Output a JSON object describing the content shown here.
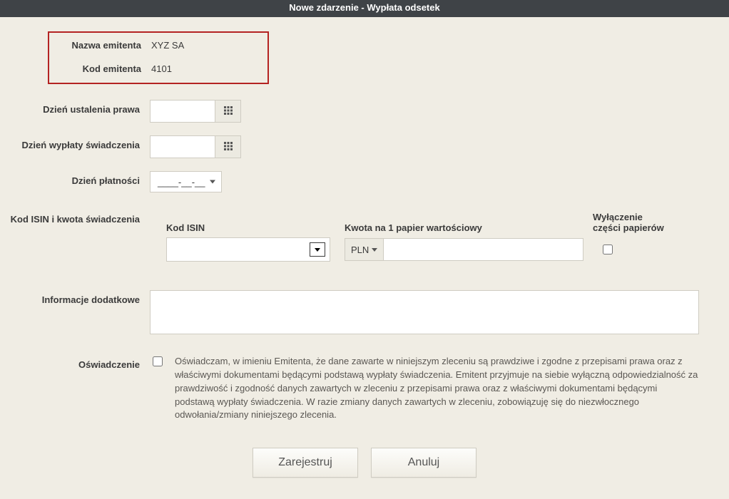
{
  "header": {
    "title": "Nowe zdarzenie - Wypłata odsetek"
  },
  "issuer": {
    "name_label": "Nazwa emitenta",
    "name_value": "XYZ SA",
    "code_label": "Kod emitenta",
    "code_value": "4101"
  },
  "fields": {
    "record_date_label": "Dzień ustalenia prawa",
    "record_date_value": "",
    "payment_date_label": "Dzień wypłaty świadczenia",
    "payment_date_value": "",
    "pay_day_label": "Dzień płatności",
    "pay_day_value": "____-__-__"
  },
  "isin_section": {
    "section_label": "Kod ISIN i kwota świadczenia",
    "col_isin": "Kod ISIN",
    "col_amount": "Kwota na 1 papier wartościowy",
    "col_exclude": "Wyłączenie\nczęści papierów",
    "isin_value": "",
    "currency": "PLN",
    "amount_value": "",
    "exclude_checked": false
  },
  "additional": {
    "label": "Informacje dodatkowe",
    "value": ""
  },
  "declaration": {
    "label": "Oświadczenie",
    "text": "Oświadczam, w imieniu Emitenta, że dane zawarte w niniejszym zleceniu są prawdziwe i zgodne z przepisami prawa oraz z właściwymi dokumentami będącymi podstawą wypłaty świadczenia. Emitent przyjmuje na siebie wyłączną odpowiedzialność za prawdziwość i zgodność danych zawartych w zleceniu z przepisami prawa oraz z właściwymi dokumentami będącymi podstawą wypłaty świadczenia. W razie zmiany danych zawartych w zleceniu, zobowiązuję się do niezwłocznego odwołania/zmiany niniejszego zlecenia.",
    "checked": false
  },
  "buttons": {
    "register": "Zarejestruj",
    "cancel": "Anuluj"
  }
}
